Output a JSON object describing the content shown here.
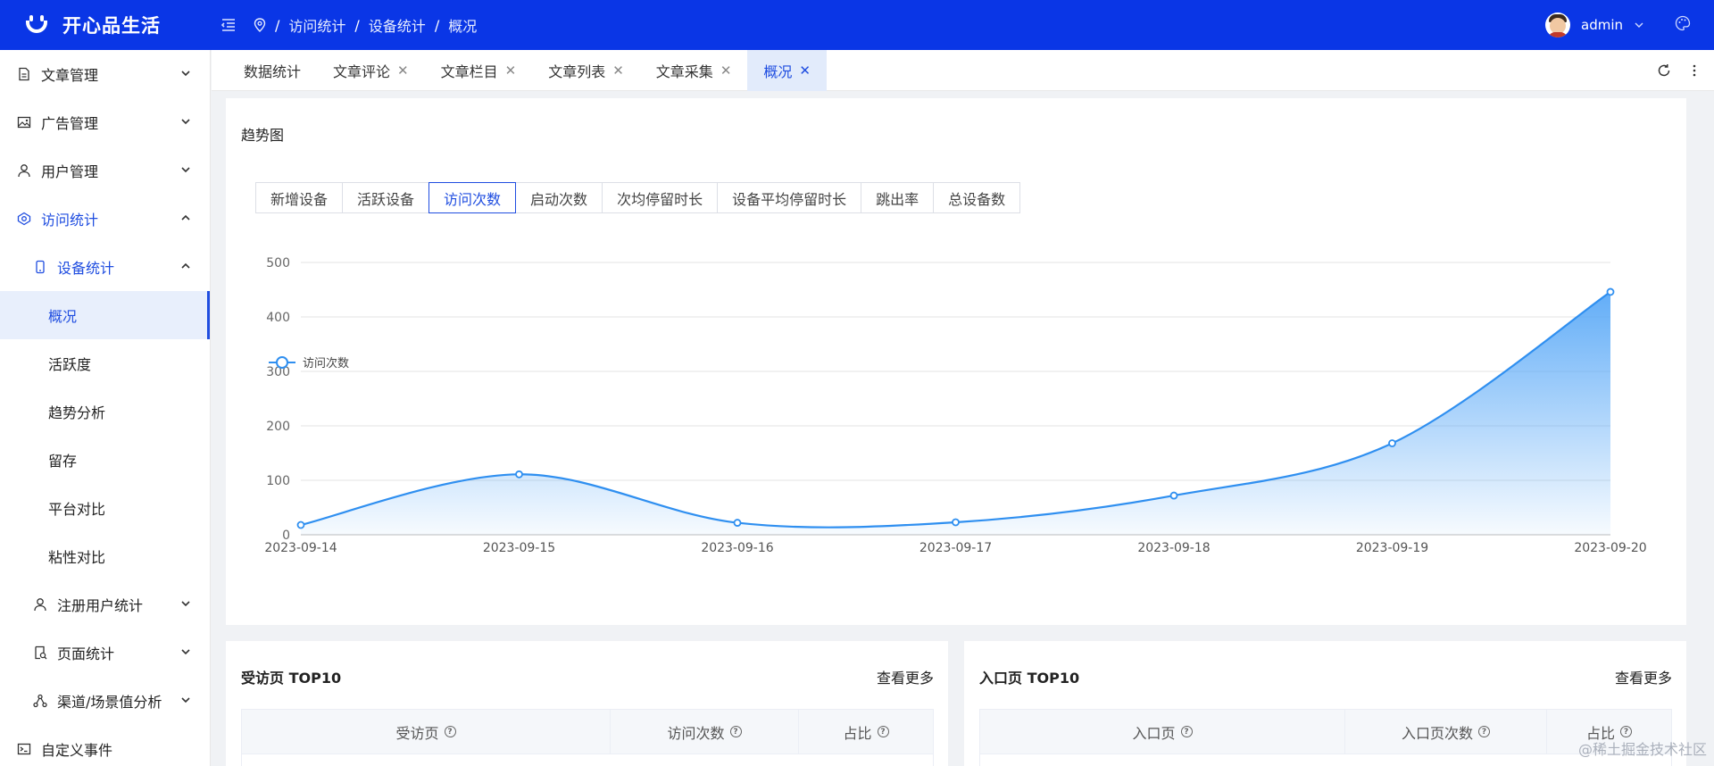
{
  "header": {
    "brand": "开心品生活",
    "breadcrumb": [
      "访问统计",
      "设备统计",
      "概况"
    ],
    "user": "admin"
  },
  "sidebar": {
    "items": [
      {
        "label": "文章管理",
        "icon": "document-icon"
      },
      {
        "label": "广告管理",
        "icon": "image-icon"
      },
      {
        "label": "用户管理",
        "icon": "user-icon"
      },
      {
        "label": "访问统计",
        "icon": "stats-icon"
      },
      {
        "label": "设备统计",
        "icon": "mobile-icon"
      },
      {
        "label": "概况"
      },
      {
        "label": "活跃度"
      },
      {
        "label": "趋势分析"
      },
      {
        "label": "留存"
      },
      {
        "label": "平台对比"
      },
      {
        "label": "粘性对比"
      },
      {
        "label": "注册用户统计",
        "icon": "user-icon"
      },
      {
        "label": "页面统计",
        "icon": "page-search-icon"
      },
      {
        "label": "渠道/场景值分析",
        "icon": "channel-icon"
      },
      {
        "label": "自定义事件",
        "icon": "terminal-icon"
      }
    ]
  },
  "tabs": [
    {
      "label": "数据统计",
      "closable": false
    },
    {
      "label": "文章评论",
      "closable": true
    },
    {
      "label": "文章栏目",
      "closable": true
    },
    {
      "label": "文章列表",
      "closable": true
    },
    {
      "label": "文章采集",
      "closable": true
    },
    {
      "label": "概况",
      "closable": true,
      "active": true
    }
  ],
  "trend": {
    "title": "趋势图",
    "metrics": [
      "新增设备",
      "活跃设备",
      "访问次数",
      "启动次数",
      "次均停留时长",
      "设备平均停留时长",
      "跳出率",
      "总设备数"
    ],
    "active_metric": "访问次数"
  },
  "chart_data": {
    "type": "area",
    "x": [
      "2023-09-14",
      "2023-09-15",
      "2023-09-16",
      "2023-09-17",
      "2023-09-18",
      "2023-09-19",
      "2023-09-20"
    ],
    "series": [
      {
        "name": "访问次数",
        "values": [
          18,
          111,
          22,
          23,
          72,
          168,
          446
        ]
      }
    ],
    "ylim": [
      0,
      500
    ],
    "yticks": [
      0,
      100,
      200,
      300,
      400,
      500
    ],
    "legend": "top-left",
    "grid": true,
    "colors": {
      "line": "#2f8ff0",
      "fill": "#5aa9f7"
    }
  },
  "top_pages": {
    "title": "受访页 TOP10",
    "more": "查看更多",
    "columns": [
      "受访页",
      "访问次数",
      "占比"
    ]
  },
  "entry_pages": {
    "title": "入口页 TOP10",
    "more": "查看更多",
    "columns": [
      "入口页",
      "入口页次数",
      "占比"
    ]
  },
  "watermark": "@稀土掘金技术社区"
}
